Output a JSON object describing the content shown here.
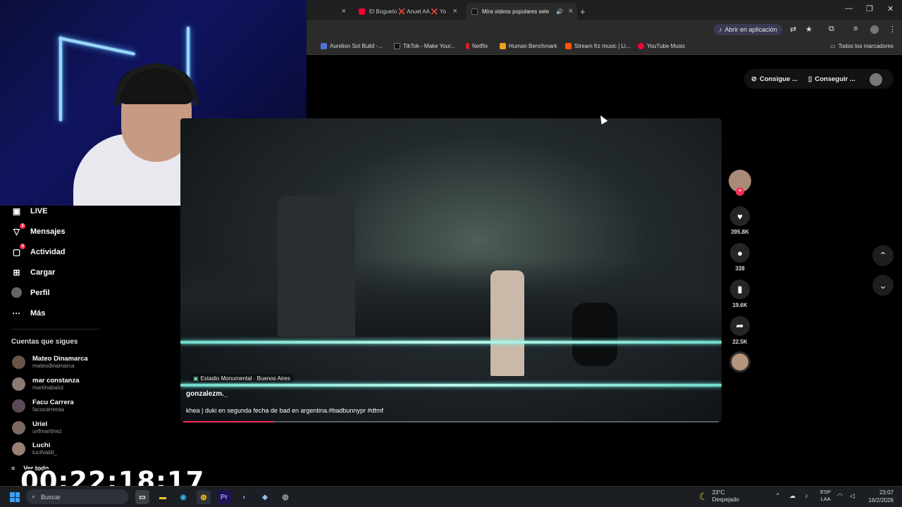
{
  "browser": {
    "tabs": [
      {
        "title": "",
        "close": "×"
      },
      {
        "title": "El Bogueto ❌ Anuel AA ❌ Yo",
        "close": "×"
      },
      {
        "title": "Mira videos populares sele",
        "close": "×",
        "active": true
      }
    ],
    "new_tab": "+",
    "open_in_app": "Abrir en aplicación",
    "bookmarks": [
      "Aurelion Sol Build -...",
      "TikTok - Make Your...",
      "Netflix",
      "Human Benchmark",
      "Stream frz music | Li...",
      "YouTube Music"
    ],
    "all_bookmarks": "Todos los marcadores"
  },
  "topbar": {
    "get_coins": "Consigue ...",
    "get_app": "Conseguir ..."
  },
  "sidebar": {
    "items": [
      {
        "label": "LIVE",
        "icon": "live-icon"
      },
      {
        "label": "Mensajes",
        "icon": "messages-icon",
        "badge": "3"
      },
      {
        "label": "Actividad",
        "icon": "activity-icon",
        "badge": "3"
      },
      {
        "label": "Cargar",
        "icon": "upload-icon"
      },
      {
        "label": "Perfil",
        "icon": "profile-icon"
      },
      {
        "label": "Más",
        "icon": "more-icon"
      }
    ],
    "following_title": "Cuentas que sigues",
    "following": [
      {
        "name": "Mateo Dinamarca",
        "handle": "mateodinamarca"
      },
      {
        "name": "mar constanza",
        "handle": "martinabalut"
      },
      {
        "name": "Facu Carrera",
        "handle": "facucarreraa"
      },
      {
        "name": "Uriel",
        "handle": "urifmartinez"
      },
      {
        "name": "Luchi",
        "handle": "lucilvaldi_"
      }
    ],
    "see_all": "Ver todo"
  },
  "stream_timer": "00:22:18:17",
  "video": {
    "location": "Estadio Monumental · Buenos Aires",
    "author": "gonzalezm._",
    "description": "khea | duki en segunda fecha de bad en argentina.#badbunnypr #dtmf",
    "progress": 0.17
  },
  "actions": {
    "likes": "395.8K",
    "comments": "338",
    "saves": "19.6K",
    "shares": "22.5K"
  },
  "taskbar": {
    "search": "Buscar",
    "weather_temp": "23°C",
    "weather_desc": "Despejado",
    "lang1": "ESP",
    "lang2": "LAA",
    "time": "23:07",
    "date": "16/2/2026"
  }
}
